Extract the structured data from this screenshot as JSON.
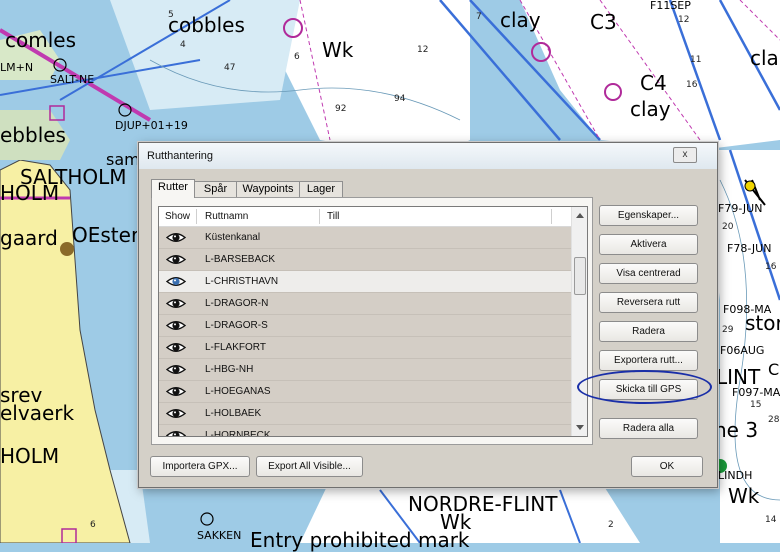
{
  "dialog": {
    "title": "Rutthantering",
    "close_label": "x",
    "tabs": [
      "Rutter",
      "Spår",
      "Waypoints",
      "Lager"
    ],
    "list": {
      "columns": [
        "Show",
        "Ruttnamn",
        "Till"
      ],
      "rows": [
        {
          "name": "Küstenkanal",
          "selected": false
        },
        {
          "name": "L-BARSEBACK",
          "selected": false
        },
        {
          "name": "L-CHRISTHAVN",
          "selected": true
        },
        {
          "name": "L-DRAGOR-N",
          "selected": false
        },
        {
          "name": "L-DRAGOR-S",
          "selected": false
        },
        {
          "name": "L-FLAKFORT",
          "selected": false
        },
        {
          "name": "L-HBG-NH",
          "selected": false
        },
        {
          "name": "L-HOEGANAS",
          "selected": false
        },
        {
          "name": "L-HOLBAEK",
          "selected": false
        },
        {
          "name": "L-HORNBECK",
          "selected": false
        }
      ]
    },
    "buttons": {
      "egenskaper": "Egenskaper...",
      "aktivera": "Aktivera",
      "visa_centrerad": "Visa centrerad",
      "reversera": "Reversera rutt",
      "radera": "Radera",
      "exportera": "Exportera rutt...",
      "skicka_gps": "Skicka till GPS",
      "radera_alla": "Radera alla",
      "importera_gpx": "Importera GPX...",
      "export_all_visible": "Export All Visible...",
      "ok": "OK"
    }
  },
  "map": {
    "labels": {
      "cobbles_top": "cobbles",
      "comles": "comles",
      "lm_n": "LM+N",
      "salt_ne": "SALT-NE",
      "cobbles_left": "ebbles",
      "djup": "DJUP+01+19",
      "saltholm": "SALTHOLM",
      "holm": "HOLM",
      "gaard": "gaard",
      "oester": "OEster",
      "wk_top": "Wk",
      "clay_top": "clay",
      "c3": "C3",
      "f11sep": "F11SEP",
      "cla_right": "cla",
      "c4": "C4",
      "clay_mid": "clay",
      "f79_jun": "F79-JUN",
      "f78_jun": "F78-JUN",
      "f098_ma": "F098-MA",
      "stor": "stor",
      "f06aug": "F06AUG",
      "f097_ma": "F097-MA",
      "lint": "LINT",
      "c_right": "C",
      "ne3": "ne 3",
      "srev": "srev",
      "elvaerk": "elvaerk",
      "holm_bottom": "HOLM",
      "nordre_flint": "NORDRE-FLINT",
      "wk_bottom": "Wk",
      "wk_right": "Wk",
      "sakken": "SAKKEN",
      "entry_prohibited": "Entry prohibited mark",
      "lindh": "LINDH",
      "sam": "sam"
    },
    "depths": [
      "5",
      "4",
      "47",
      "12",
      "92",
      "94",
      "7",
      "6",
      "12",
      "11",
      "16",
      "20",
      "16",
      "29",
      "28",
      "14",
      "2",
      "16",
      "15",
      "6"
    ]
  },
  "colors": {
    "water": "#9ecbe6",
    "land": "#f7f0a4",
    "route_magenta": "#c03ab0",
    "route_blue": "#3a6fd8",
    "annotation": "#1a2fa8"
  }
}
